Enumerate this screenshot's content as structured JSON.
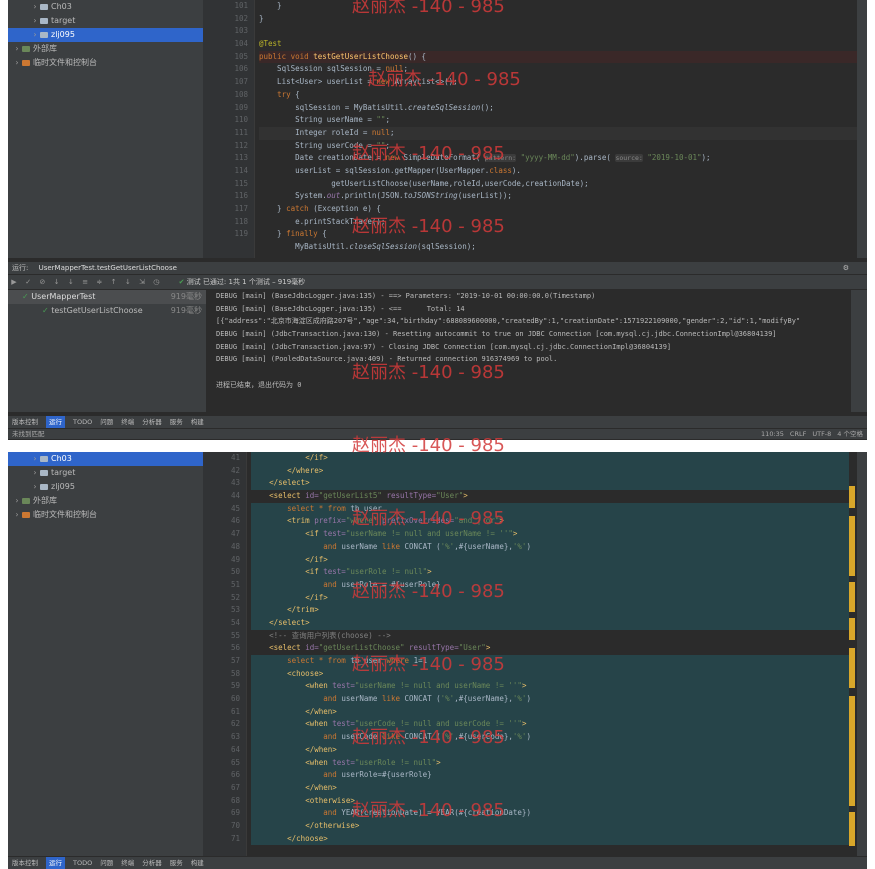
{
  "watermark": "赵丽杰 -140 - 985",
  "project_tree": {
    "items": [
      {
        "label": "Ch03",
        "type": "folder",
        "selected": false
      },
      {
        "label": "target",
        "type": "folder",
        "selected": false
      },
      {
        "label": "zlj095",
        "type": "folder",
        "selected": true
      },
      {
        "label": "外部库",
        "type": "lib",
        "selected": false
      },
      {
        "label": "临时文件和控制台",
        "type": "tmp",
        "selected": false
      }
    ]
  },
  "project_tree2": {
    "items": [
      {
        "label": "Ch03",
        "type": "folder",
        "selected": true
      },
      {
        "label": "target",
        "type": "folder",
        "selected": false
      },
      {
        "label": "zlj095",
        "type": "folder",
        "selected": false
      },
      {
        "label": "外部库",
        "type": "lib",
        "selected": false
      },
      {
        "label": "临时文件和控制台",
        "type": "tmp",
        "selected": false
      }
    ]
  },
  "editor1": {
    "line_numbers": [
      "101",
      "102",
      "103",
      "104",
      "105",
      "106",
      "107",
      "108",
      "109",
      "110",
      "111",
      "112",
      "113",
      "114",
      "115",
      "116",
      "117",
      "118",
      "119"
    ]
  },
  "run": {
    "tab": "UserMapperTest.testGetUserListChoose",
    "status": "测试 已通过: 1共 1 个测试 – 919毫秒",
    "tree": [
      {
        "label": "UserMapperTest",
        "time": "919毫秒"
      },
      {
        "label": "testGetUserListChoose",
        "time": "919毫秒"
      }
    ],
    "console": [
      "DEBUG [main] (BaseJdbcLogger.java:135) - ==> Parameters: \"2019-10-01 00:00:00.0(Timestamp)",
      "DEBUG [main] (BaseJdbcLogger.java:135) - <==      Total: 14",
      "[{\"address\":\"北京市海淀区成府路207号\",\"age\":34,\"birthday\":688089600000,\"createdBy\":1,\"creationDate\":1571922109000,\"gender\":2,\"id\":1,\"modifyBy\"",
      "DEBUG [main] (JdbcTransaction.java:130) - Resetting autocommit to true on JDBC Connection [com.mysql.cj.jdbc.ConnectionImpl@36804139]",
      "DEBUG [main] (JdbcTransaction.java:97) - Closing JDBC Connection [com.mysql.cj.jdbc.ConnectionImpl@36804139]",
      "DEBUG [main] (PooledDataSource.java:409) - Returned connection 916374969 to pool.",
      "",
      "进程已结束，退出代码为 0"
    ]
  },
  "bottom_tabs": [
    "版本控制",
    "运行",
    "TODO",
    "问题",
    "终端",
    "分析器",
    "服务",
    "构建"
  ],
  "status": {
    "left": "未找到匹配",
    "right": [
      "110:35",
      "CRLF",
      "UTF-8",
      "4 个空格"
    ]
  },
  "editor2": {
    "line_numbers": [
      "41",
      "42",
      "43",
      "44",
      "45",
      "46",
      "47",
      "48",
      "49",
      "50",
      "51",
      "52",
      "53",
      "54",
      "55",
      "56",
      "57",
      "58",
      "59",
      "60",
      "61",
      "62",
      "63",
      "64",
      "65",
      "66",
      "67",
      "68",
      "69",
      "70",
      "71"
    ]
  }
}
